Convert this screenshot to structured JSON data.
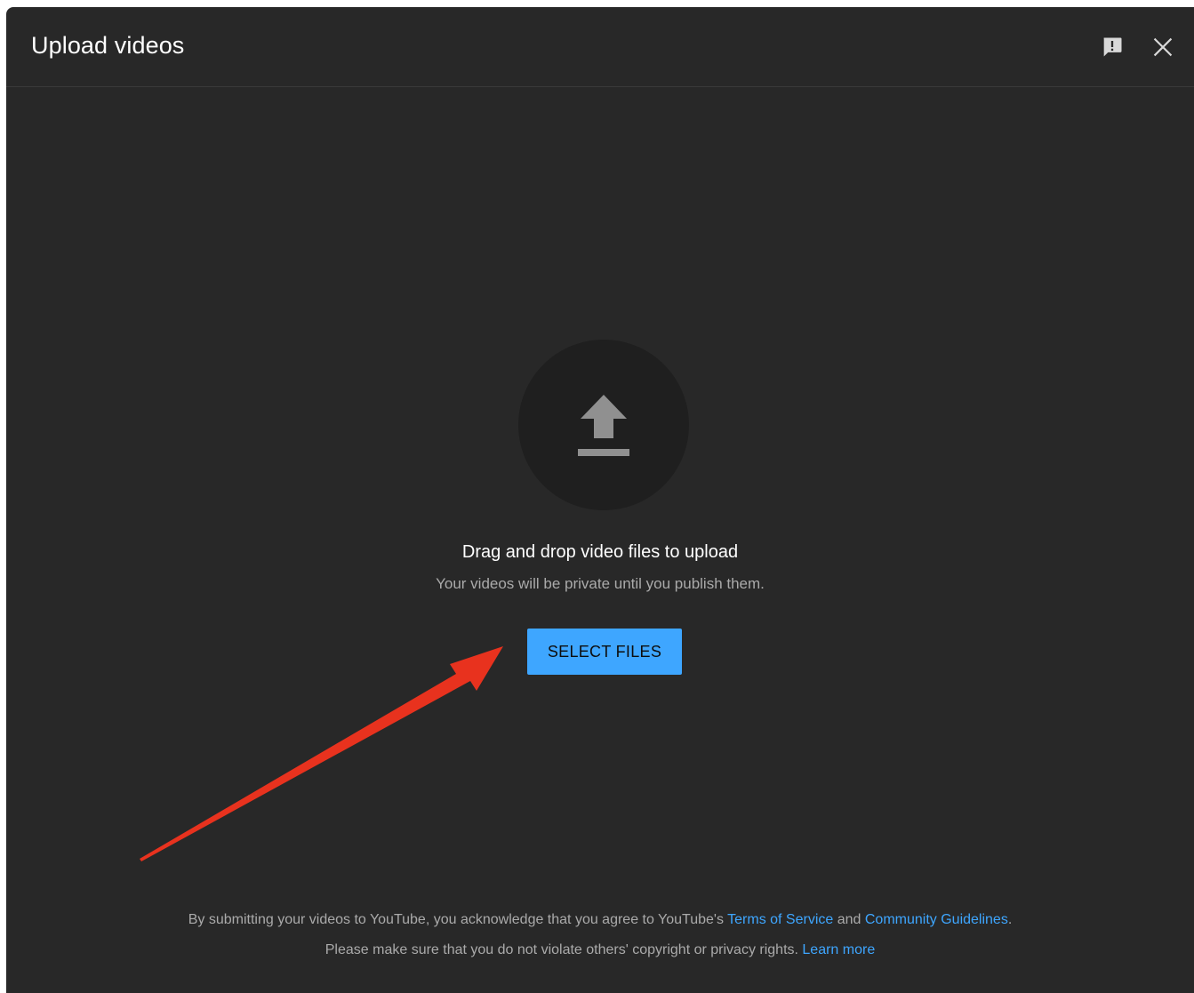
{
  "dialog": {
    "title": "Upload videos",
    "icons": {
      "feedback": "feedback-icon",
      "close": "close-icon"
    }
  },
  "main": {
    "upload_icon": "upload-arrow-icon",
    "drag_text": "Drag and drop video files to upload",
    "private_text": "Your videos will be private until you publish them.",
    "select_button_label": "SELECT FILES"
  },
  "footer": {
    "line1_prefix": "By submitting your videos to YouTube, you acknowledge that you agree to YouTube's ",
    "terms_link": "Terms of Service",
    "line1_and": " and ",
    "guidelines_link": "Community Guidelines",
    "line1_suffix": ".",
    "line2_prefix": "Please make sure that you do not violate others' copyright or privacy rights. ",
    "learn_more_link": "Learn more"
  },
  "colors": {
    "dialog_background": "#282828",
    "accent": "#3ea6ff",
    "annotation_arrow": "#e8321e"
  }
}
